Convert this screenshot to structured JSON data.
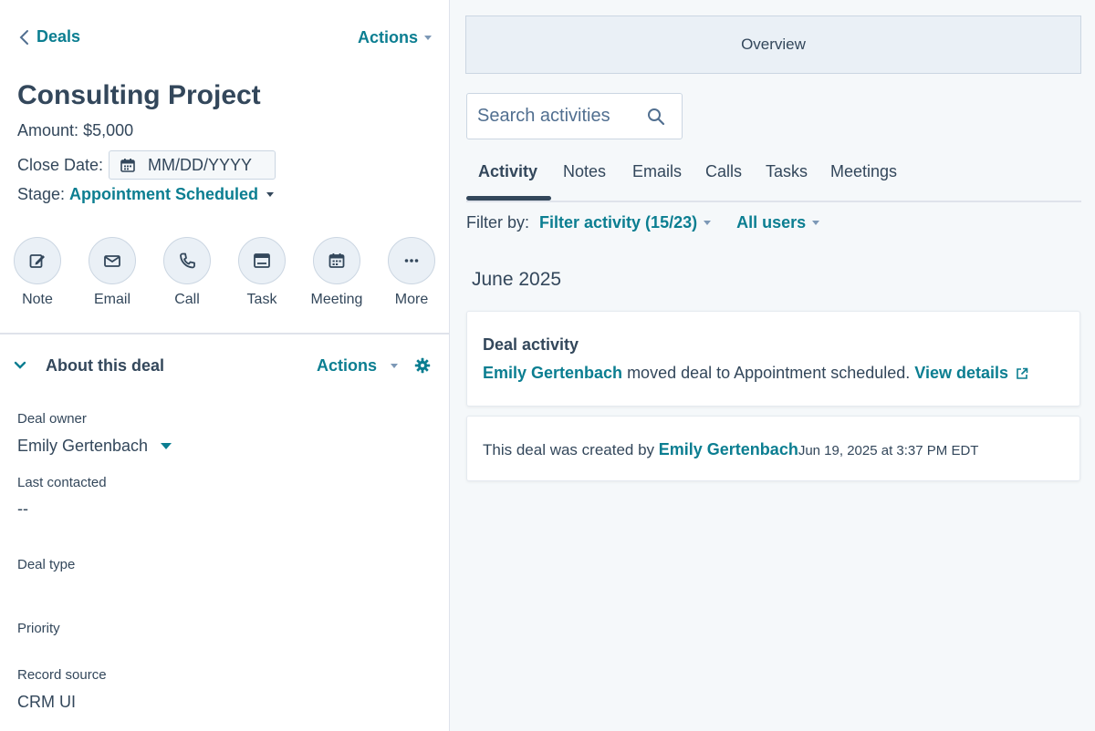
{
  "header": {
    "back_label": "Deals",
    "actions_label": "Actions"
  },
  "record": {
    "title": "Consulting Project",
    "amount_label": "Amount:",
    "amount_value": "$5,000",
    "close_date_label": "Close Date:",
    "close_date_placeholder": "MM/DD/YYYY",
    "stage_label": "Stage:",
    "stage_value": "Appointment Scheduled"
  },
  "activity_buttons": [
    {
      "label": "Note",
      "icon": "note-icon"
    },
    {
      "label": "Email",
      "icon": "email-icon"
    },
    {
      "label": "Call",
      "icon": "call-icon"
    },
    {
      "label": "Task",
      "icon": "task-icon"
    },
    {
      "label": "Meeting",
      "icon": "meeting-icon"
    },
    {
      "label": "More",
      "icon": "more-icon"
    }
  ],
  "about": {
    "title": "About this deal",
    "actions_label": "Actions",
    "properties": [
      {
        "label": "Deal owner",
        "value": "Emily Gertenbach"
      },
      {
        "label": "Last contacted",
        "value": "--"
      },
      {
        "label": "Deal type",
        "value": ""
      },
      {
        "label": "Priority",
        "value": ""
      },
      {
        "label": "Record source",
        "value": "CRM UI"
      }
    ]
  },
  "timeline": {
    "overview_label": "Overview",
    "search_placeholder": "Search activities",
    "tabs": [
      "Activity",
      "Notes",
      "Emails",
      "Calls",
      "Tasks",
      "Meetings"
    ],
    "active_tab": "Activity",
    "filter_by_label": "Filter by:",
    "filter_activity_label": "Filter activity (15/23)",
    "all_users_label": "All users",
    "month_label": "June 2025",
    "cards": [
      {
        "title": "Deal activity",
        "user": "Emily Gertenbach",
        "text": " moved deal to Appointment scheduled. ",
        "link": "View details"
      },
      {
        "prefix": "This deal was created by ",
        "user": "Emily Gertenbach",
        "timestamp": "Jun 19, 2025 at 3:37 PM EDT"
      }
    ]
  },
  "colors": {
    "accent": "#0b7e91",
    "text": "#33475b",
    "panel_bg": "#f5f8fa",
    "border": "#cbd6e2"
  }
}
